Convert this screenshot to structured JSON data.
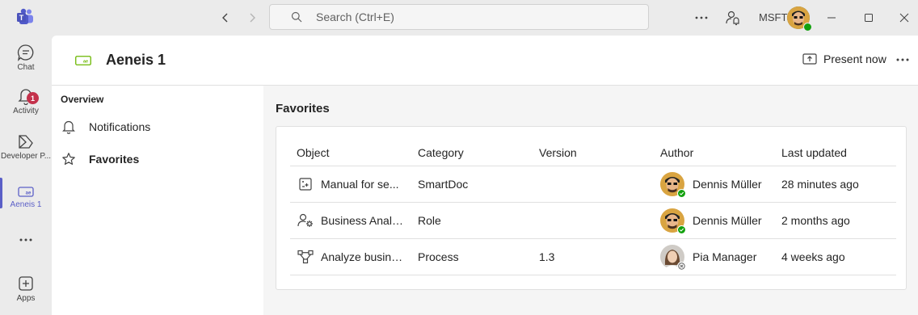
{
  "titlebar": {
    "search_placeholder": "Search (Ctrl+E)",
    "org_label": "MSFT",
    "icons": [
      "teams-logo-icon",
      "back-arrow-icon",
      "forward-arrow-icon",
      "search-icon",
      "more-options-icon",
      "person-bell-icon",
      "minimize-icon",
      "maximize-icon",
      "close-icon"
    ]
  },
  "rail": {
    "items": [
      {
        "label": "Chat",
        "icon": "chat-icon"
      },
      {
        "label": "Activity",
        "icon": "bell-icon",
        "badge": "1"
      },
      {
        "label": "Developer P...",
        "icon": "developer-portal-icon"
      },
      {
        "label": "Aeneis 1",
        "icon": "aeneis-app-icon",
        "active": true
      },
      {
        "label": "",
        "icon": "more-apps-icon"
      },
      {
        "label": "Apps",
        "icon": "plus-square-icon"
      }
    ]
  },
  "app": {
    "title": "Aeneis 1",
    "present_label": "Present now"
  },
  "sidenav": {
    "heading": "Overview",
    "items": [
      {
        "label": "Notifications",
        "icon": "bell-outline-icon"
      },
      {
        "label": "Favorites",
        "icon": "star-icon",
        "selected": true
      }
    ]
  },
  "content": {
    "title": "Favorites",
    "columns": [
      "Object",
      "Category",
      "Version",
      "Author",
      "Last updated"
    ],
    "rows": [
      {
        "object": "Manual for se...",
        "icon": "document-icon",
        "category": "SmartDoc",
        "version": "",
        "author": "Dennis Müller",
        "author_status": "available",
        "updated": "28 minutes ago"
      },
      {
        "object": "Business Analyst",
        "icon": "person-gear-icon",
        "category": "Role",
        "version": "",
        "author": "Dennis Müller",
        "author_status": "available",
        "updated": "2 months ago"
      },
      {
        "object": "Analyze busine...",
        "icon": "process-flow-icon",
        "category": "Process",
        "version": "1.3",
        "author": "Pia Manager",
        "author_status": "offline",
        "updated": "4 weeks ago"
      }
    ]
  },
  "colors": {
    "accent": "#5b5fc7",
    "available": "#13a10e",
    "badge": "#c4314b",
    "app_icon": "#6bb700"
  }
}
